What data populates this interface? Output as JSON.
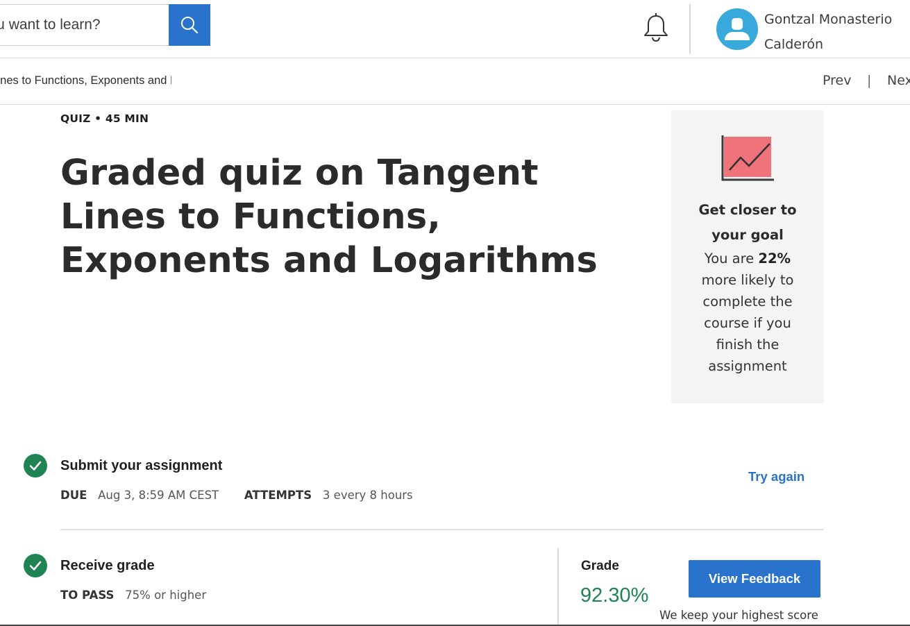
{
  "header": {
    "search_text": "you want to learn?",
    "search_button_icon": "search-icon",
    "notification_icon": "bell-icon",
    "user_name": "Gontzal Monasterio\nCalderón",
    "avatar_icon": "user-icon",
    "colors": {
      "brand_blue": "#2a73cc",
      "avatar_bg": "#38a9da"
    }
  },
  "nav": {
    "breadcrumb": "Tangent Lines to Functions, Exponents and Logarithms",
    "prev_label": "Prev",
    "separator": "|",
    "next_label": "Next"
  },
  "assignment": {
    "meta": "QUIZ • 45 MIN",
    "title": "Graded quiz on Tangent Lines to Functions, Exponents and Logarithms"
  },
  "goal_card": {
    "icon": "chart-icon",
    "heading": "Get closer to your goal",
    "text_before": "You are ",
    "highlight": "22%",
    "text_after": " more likely to complete the course if you finish the assignment"
  },
  "steps": [
    {
      "status_icon": "check-icon",
      "title": "Submit your assignment",
      "due_key": "DUE",
      "due_value": "Aug 3, 8:59 AM CEST",
      "attempts_key": "ATTEMPTS",
      "attempts_value": "3 every 8 hours",
      "action_label": "Try again"
    },
    {
      "status_icon": "check-icon",
      "title": "Receive grade",
      "pass_key": "TO PASS",
      "pass_value": "75% or higher",
      "grade_label": "Grade",
      "grade_value": "92.30%",
      "action_label": "View Feedback",
      "note": "We keep your highest score"
    }
  ],
  "colors": {
    "success_green": "#1f8354",
    "card_bg": "#f4f4f4",
    "chart_fill": "#f0727a"
  }
}
